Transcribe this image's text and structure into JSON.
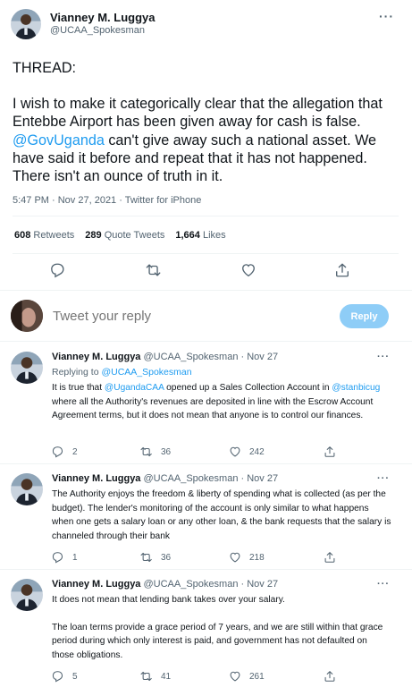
{
  "main_tweet": {
    "author_name": "Vianney M. Luggya",
    "author_handle": "@UCAA_Spokesman",
    "more_icon": "more-dots-icon",
    "thread_label": "THREAD:",
    "text_part1": "I wish to make it categorically clear that the allegation that Entebbe Airport has been given away for cash is false. ",
    "mention": "@GovUganda",
    "text_part2": " can't give away such a national asset. We have said it before and repeat that it has not happened. There isn't an ounce of truth in it.",
    "timestamp": "5:47 PM · Nov 27, 2021 · Twitter for iPhone",
    "stats": {
      "retweets_count": "608",
      "retweets_label": "Retweets",
      "quotes_count": "289",
      "quotes_label": "Quote Tweets",
      "likes_count": "1,664",
      "likes_label": "Likes"
    }
  },
  "reply_box": {
    "placeholder": "Tweet your reply",
    "button_label": "Reply"
  },
  "replies": [
    {
      "name": "Vianney M. Luggya",
      "handle": "@UCAA_Spokesman",
      "sep": " · ",
      "date": "Nov 27",
      "replying_label": "Replying to ",
      "replying_to": "@UCAA_Spokesman",
      "t1": "It is true that ",
      "m1": "@UgandaCAA",
      "t2": " opened up a Sales Collection Account in ",
      "m2": "@stanbicug",
      "t3": " where all the Authority's revenues are deposited in line with the Escrow Account Agreement terms, but it does not mean that anyone is to control our finances.",
      "replies": "2",
      "retweets": "36",
      "likes": "242"
    },
    {
      "name": "Vianney M. Luggya",
      "handle": "@UCAA_Spokesman",
      "sep": " · ",
      "date": "Nov 27",
      "text": "The Authority enjoys the freedom & liberty of spending what is collected (as per the budget). The lender's monitoring of the account is only similar to what happens when one gets a salary loan or any other loan, & the bank requests that the salary is channeled through their bank",
      "replies": "1",
      "retweets": "36",
      "likes": "218"
    },
    {
      "name": "Vianney M. Luggya",
      "handle": "@UCAA_Spokesman",
      "sep": " · ",
      "date": "Nov 27",
      "text_p1": "It does not mean that lending bank takes over your salary.",
      "text_p2": "The loan terms provide a grace period of 7 years, and we are still within that grace period during which only interest is paid, and government has not defaulted on those obligations.",
      "replies": "5",
      "retweets": "41",
      "likes": "261"
    }
  ],
  "colors": {
    "link": "#1d9bf0",
    "secondary_text": "#536471",
    "reply_button": "#8ecdf7",
    "divider": "#eff3f4"
  },
  "icons": [
    "reply-icon",
    "retweet-icon",
    "like-icon",
    "share-icon",
    "more-dots-icon"
  ]
}
